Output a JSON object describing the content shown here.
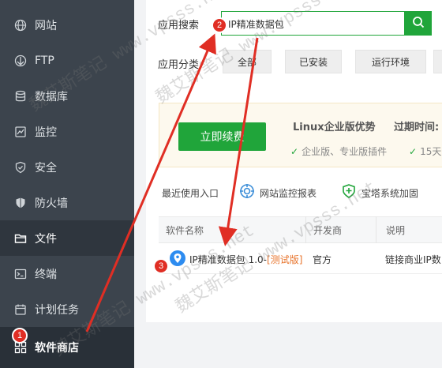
{
  "sidebar": {
    "items": [
      {
        "label": "网站",
        "icon": "globe-icon"
      },
      {
        "label": "FTP",
        "icon": "ftp-icon"
      },
      {
        "label": "数据库",
        "icon": "database-icon"
      },
      {
        "label": "监控",
        "icon": "monitor-icon"
      },
      {
        "label": "安全",
        "icon": "shield-icon"
      },
      {
        "label": "防火墙",
        "icon": "firewall-icon"
      },
      {
        "label": "文件",
        "icon": "folder-icon"
      },
      {
        "label": "终端",
        "icon": "terminal-icon"
      },
      {
        "label": "计划任务",
        "icon": "clock-icon"
      },
      {
        "label": "软件商店",
        "icon": "apps-icon"
      }
    ]
  },
  "search": {
    "label": "应用搜索",
    "value": "IP精准数据包"
  },
  "categories": {
    "label": "应用分类",
    "items": [
      "全部",
      "已安装",
      "运行环境"
    ]
  },
  "promo": {
    "renew_label": "立即续费",
    "title": "Linux企业版优势",
    "expire_label": "过期时间:",
    "features": [
      "企业版、专业版插件",
      "15天"
    ]
  },
  "quick": {
    "title": "最近使用入口",
    "links": [
      "网站监控报表",
      "宝塔系统加固"
    ]
  },
  "table": {
    "headers": [
      "软件名称",
      "开发商",
      "说明"
    ],
    "rows": [
      {
        "name": "IP精准数据包 1.0-",
        "tag": "[测试版]",
        "vendor": "官方",
        "desc": "链接商业IP数"
      }
    ]
  },
  "annotations": {
    "badges": [
      "1",
      "2",
      "3"
    ],
    "watermark": "魏艾斯笔记 www.vpsss.net",
    "color": "#e02e24"
  },
  "colors": {
    "accent": "#20a53a",
    "sidebar_bg": "#3c444d",
    "tag": "#e8742c"
  }
}
